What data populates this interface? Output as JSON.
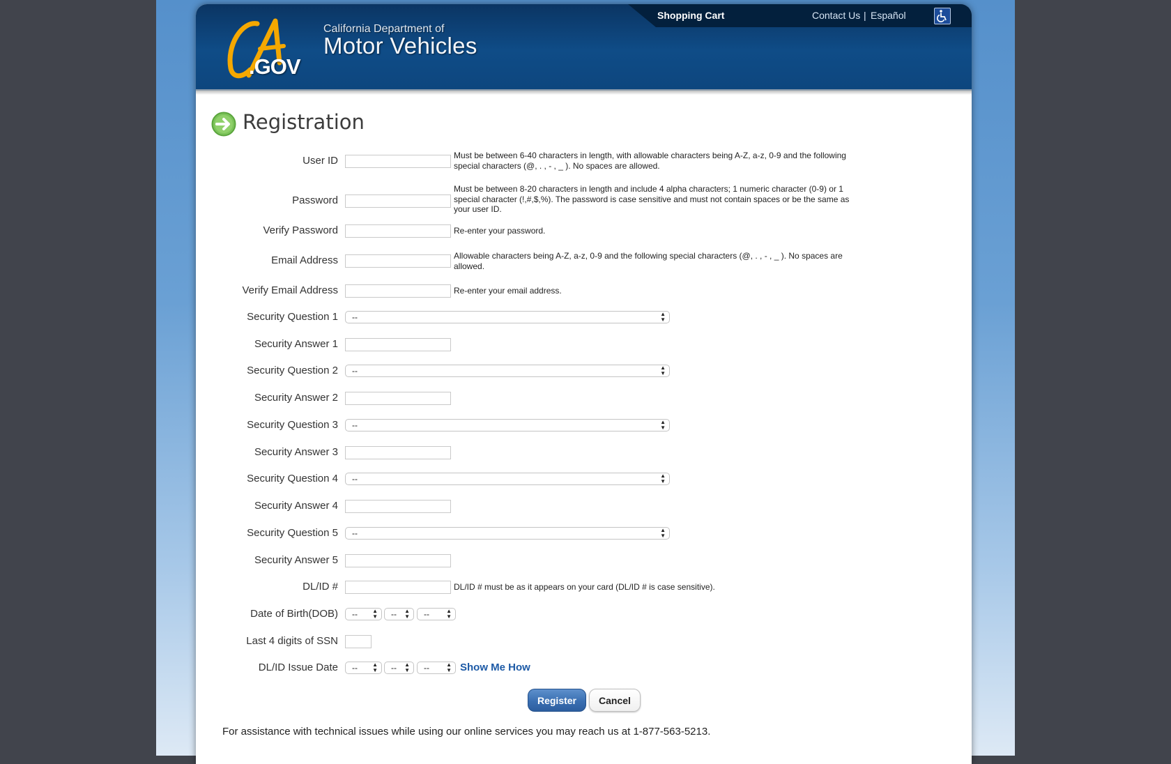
{
  "header": {
    "logo_ca": "CA",
    "logo_gov": ".GOV",
    "dept_line1": "California Department of",
    "dept_line2": "Motor Vehicles",
    "links": {
      "shopping_cart": "Shopping Cart",
      "contact_us": "Contact Us",
      "separator": "|",
      "espanol": "Español"
    },
    "accessibility_icon": "wheelchair-icon"
  },
  "page": {
    "title": "Registration",
    "title_icon": "arrow-right-circle-icon"
  },
  "form": {
    "user_id": {
      "label": "User ID",
      "value": "",
      "help": "Must be between 6-40 characters in length, with allowable characters being A-Z, a-z, 0-9 and the following special characters (@, . , - , _ ). No spaces are allowed."
    },
    "password": {
      "label": "Password",
      "value": "",
      "help": "Must be between 8-20 characters in length and include 4 alpha characters; 1 numeric character (0-9) or 1 special character (!,#,$,%). The password is case sensitive and must not contain spaces or be the same as your user ID."
    },
    "verify_password": {
      "label": "Verify Password",
      "value": "",
      "help": "Re-enter your password."
    },
    "email": {
      "label": "Email Address",
      "value": "",
      "help": "Allowable characters being A-Z, a-z, 0-9 and the following special characters (@, . , - , _ ). No spaces are allowed."
    },
    "verify_email": {
      "label": "Verify Email Address",
      "value": "",
      "help": "Re-enter your email address."
    },
    "security": [
      {
        "question_label": "Security Question 1",
        "question_value": "--",
        "answer_label": "Security Answer 1",
        "answer_value": ""
      },
      {
        "question_label": "Security Question 2",
        "question_value": "--",
        "answer_label": "Security Answer 2",
        "answer_value": ""
      },
      {
        "question_label": "Security Question 3",
        "question_value": "--",
        "answer_label": "Security Answer 3",
        "answer_value": ""
      },
      {
        "question_label": "Security Question 4",
        "question_value": "--",
        "answer_label": "Security Answer 4",
        "answer_value": ""
      },
      {
        "question_label": "Security Question 5",
        "question_value": "--",
        "answer_label": "Security Answer 5",
        "answer_value": ""
      }
    ],
    "dl_id": {
      "label": "DL/ID #",
      "value": "",
      "help": "DL/ID # must be as it appears on your card (DL/ID # is case sensitive)."
    },
    "dob": {
      "label": "Date of Birth(DOB)",
      "month": "--",
      "day": "--",
      "year": "--"
    },
    "ssn_last4": {
      "label": "Last 4 digits of SSN",
      "value": ""
    },
    "issue_date": {
      "label": "DL/ID Issue Date",
      "month": "--",
      "day": "--",
      "year": "--",
      "show_me_how": "Show Me How"
    },
    "buttons": {
      "register": "Register",
      "cancel": "Cancel"
    }
  },
  "footer": {
    "assistance": "For assistance with technical issues while using our online services you may reach us at 1-877-563-5213."
  }
}
